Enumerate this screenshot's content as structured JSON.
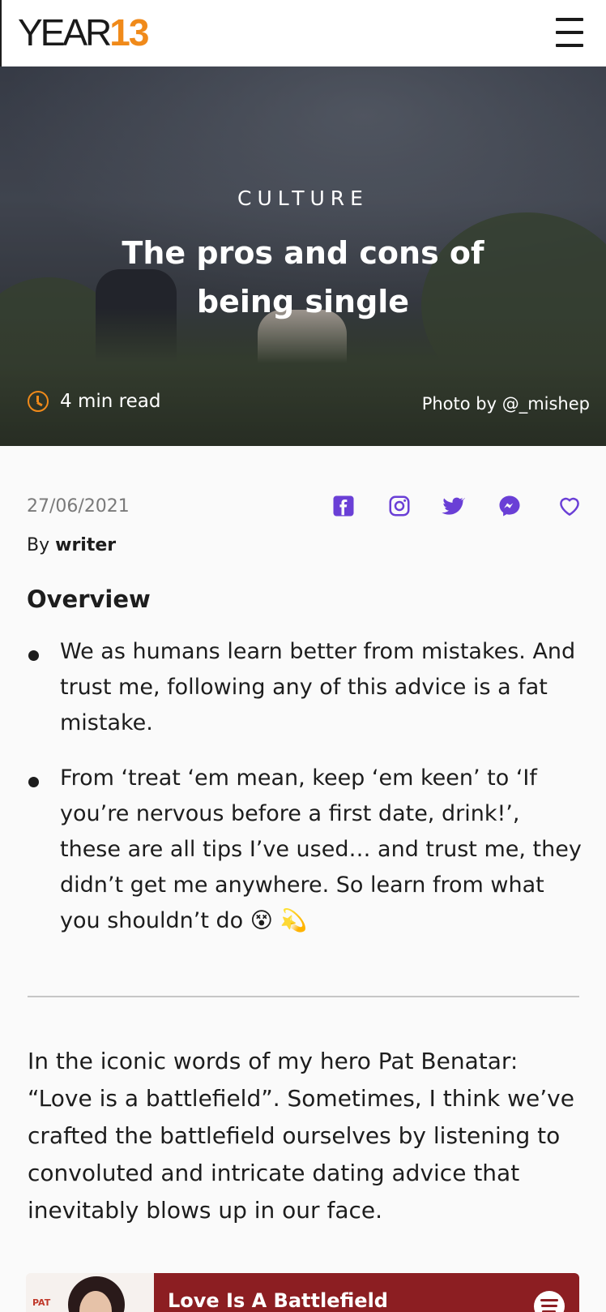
{
  "header": {
    "logo_word": "YEAR",
    "logo_num": "13",
    "menu_icon": "hamburger-icon"
  },
  "hero": {
    "category": "CULTURE",
    "title": "The pros and cons of being single",
    "read_time": "4 min read",
    "photo_credit": "Photo by @_mishep"
  },
  "meta": {
    "date": "27/06/2021",
    "by_label": "By",
    "author": "writer"
  },
  "share": {
    "icons": [
      "facebook-icon",
      "instagram-icon",
      "twitter-icon",
      "messenger-icon",
      "heart-icon"
    ],
    "accent": "#6a3fd6"
  },
  "overview": {
    "heading": "Overview",
    "bullets": [
      "We as humans learn better from mistakes. And trust me, following any of this advice is a fat mistake.",
      "From ‘treat ‘em mean, keep ‘em keen’ to ‘If you’re nervous before a first date, drink!’, these are all tips I’ve used… and trust me, they didn’t get me anywhere. So learn from what you shouldn’t do 😵 💫"
    ]
  },
  "body": {
    "paragraph": "In the iconic words of my hero Pat Benatar: “Love is a battlefield”. Sometimes, I think we’ve crafted the battlefield ourselves by listening to convoluted and intricate dating advice that inevitably blows up in our face."
  },
  "embed": {
    "cover_text": "PAT",
    "track_title": "Love Is A Battlefield"
  },
  "colors": {
    "brand_orange": "#f08a1a",
    "share_purple": "#6a3fd6",
    "embed_red": "#8c1e22"
  }
}
